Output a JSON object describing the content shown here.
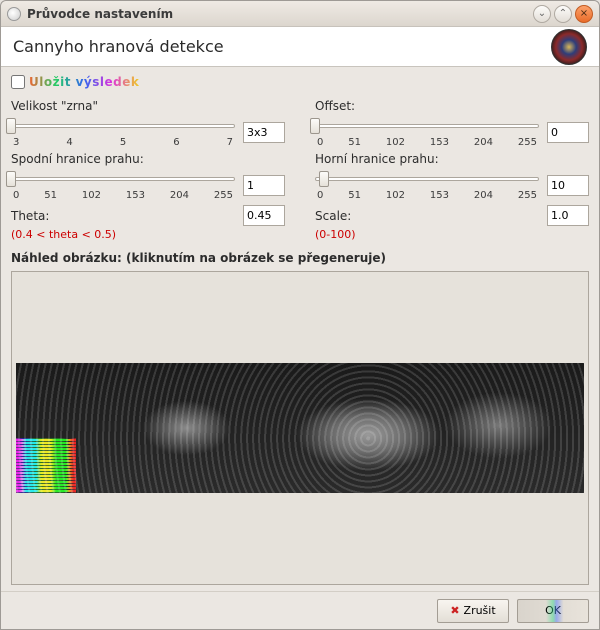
{
  "window": {
    "title": "Průvodce nastavením"
  },
  "header": {
    "title": "Cannyho hranová detekce"
  },
  "save": {
    "label": "Uložit výsledek",
    "checked": false
  },
  "left": {
    "grain": {
      "label": "Velikost \"zrna\"",
      "value": "3x3",
      "ticks": [
        "3",
        "4",
        "5",
        "6",
        "7"
      ],
      "pos_pct": 0
    },
    "lower": {
      "label": "Spodní hranice prahu:",
      "value": "1",
      "ticks": [
        "0",
        "51",
        "102",
        "153",
        "204",
        "255"
      ],
      "pos_pct": 0
    },
    "theta": {
      "label": "Theta:",
      "value": "0.45",
      "hint": "(0.4 < theta < 0.5)"
    }
  },
  "right": {
    "offset": {
      "label": "Offset:",
      "value": "0",
      "ticks": [
        "0",
        "51",
        "102",
        "153",
        "204",
        "255"
      ],
      "pos_pct": 0
    },
    "upper": {
      "label": "Horní hranice prahu:",
      "value": "10",
      "ticks": [
        "0",
        "51",
        "102",
        "153",
        "204",
        "255"
      ],
      "pos_pct": 4
    },
    "scale": {
      "label": "Scale:",
      "value": "1.0",
      "hint": "(0-100)"
    }
  },
  "preview": {
    "label": "Náhled obrázku: (kliknutím na obrázek se přegeneruje)"
  },
  "footer": {
    "cancel": "Zrušit",
    "ok": "OK"
  }
}
